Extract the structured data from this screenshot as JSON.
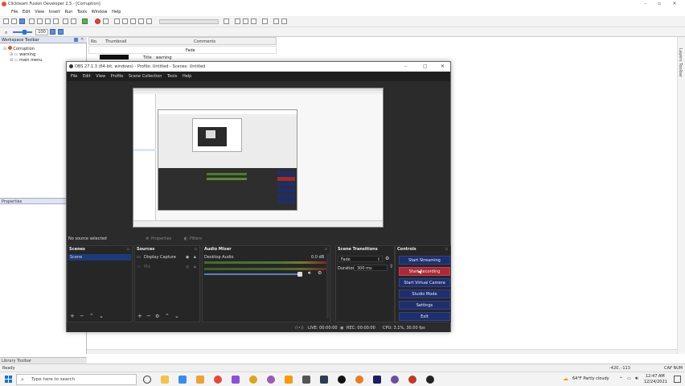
{
  "bg_app": {
    "title": "Clickteam Fusion Developer 2.5 - [Corruption]",
    "menu": [
      "File",
      "Edit",
      "View",
      "Insert",
      "Run",
      "Tools",
      "Window",
      "Help"
    ],
    "zoom_value": "100",
    "workspace_title": "Workspace Toolbar",
    "tree": {
      "root": "Corruption",
      "items": [
        "warning",
        "main menu"
      ]
    },
    "list_headers": {
      "no": "No.",
      "thumb": "Thumbnail",
      "comments": "Comments"
    },
    "list_rows": {
      "fade": "Fade",
      "title": "Title : warning"
    },
    "properties_title": "Properties",
    "library_title": "Library Toolbar",
    "right_panel_label": "Layers Toolbar",
    "status_ready": "Ready",
    "status_coords": "-420, -113",
    "status_caps": "CAP NUM"
  },
  "obs": {
    "title": "OBS 27.1.3 (64-bit, windows) - Profile: Untitled - Scenes: Untitled",
    "menu": [
      "File",
      "Edit",
      "View",
      "Profile",
      "Scene Collection",
      "Tools",
      "Help"
    ],
    "info": {
      "no_source": "No source selected",
      "properties": "Properties",
      "filters": "Filters"
    },
    "docks": {
      "scenes": {
        "title": "Scenes",
        "items": [
          "Scene"
        ]
      },
      "sources": {
        "title": "Sources",
        "items": [
          "Display Capture",
          "Mic"
        ]
      },
      "mixer": {
        "title": "Audio Mixer",
        "channel": "Desktop Audio",
        "db": "0.0 dB"
      },
      "transitions": {
        "title": "Scene Transitions",
        "type": "Fade",
        "duration_label": "Duration",
        "duration_value": "300 ms"
      },
      "controls": {
        "title": "Controls",
        "buttons": [
          "Start Streaming",
          "Start Recording",
          "Start Virtual Camera",
          "Studio Mode",
          "Settings",
          "Exit"
        ]
      }
    },
    "status": {
      "live": "LIVE: 00:00:00",
      "rec": "REC: 00:00:00",
      "cpu": "CPU: 3.1%, 30.00 fps"
    }
  },
  "taskbar": {
    "search_placeholder": "Type here to search",
    "weather": "64°F  Partly cloudy",
    "time": "12:47 AM",
    "date": "12/24/2021"
  },
  "colors": {
    "obs_bg": "#2b2b2b",
    "obs_button": "#1f2f6e",
    "obs_button_active": "#a82b3b",
    "selection": "#1e3a78"
  }
}
